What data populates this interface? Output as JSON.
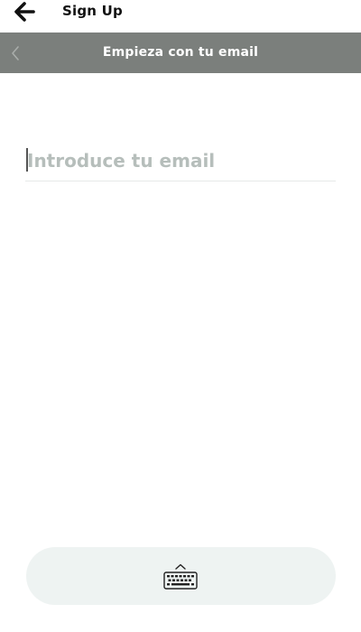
{
  "header": {
    "title": "Sign Up",
    "back_icon": "arrow-left-icon"
  },
  "nav": {
    "title": "Empieza con tu email",
    "back_icon": "chevron-left-icon",
    "background_color": "#7b7f7c"
  },
  "form": {
    "email": {
      "value": "",
      "placeholder": "Introduce tu email"
    }
  },
  "keyboard_toggle": {
    "icon": "keyboard-icon"
  }
}
